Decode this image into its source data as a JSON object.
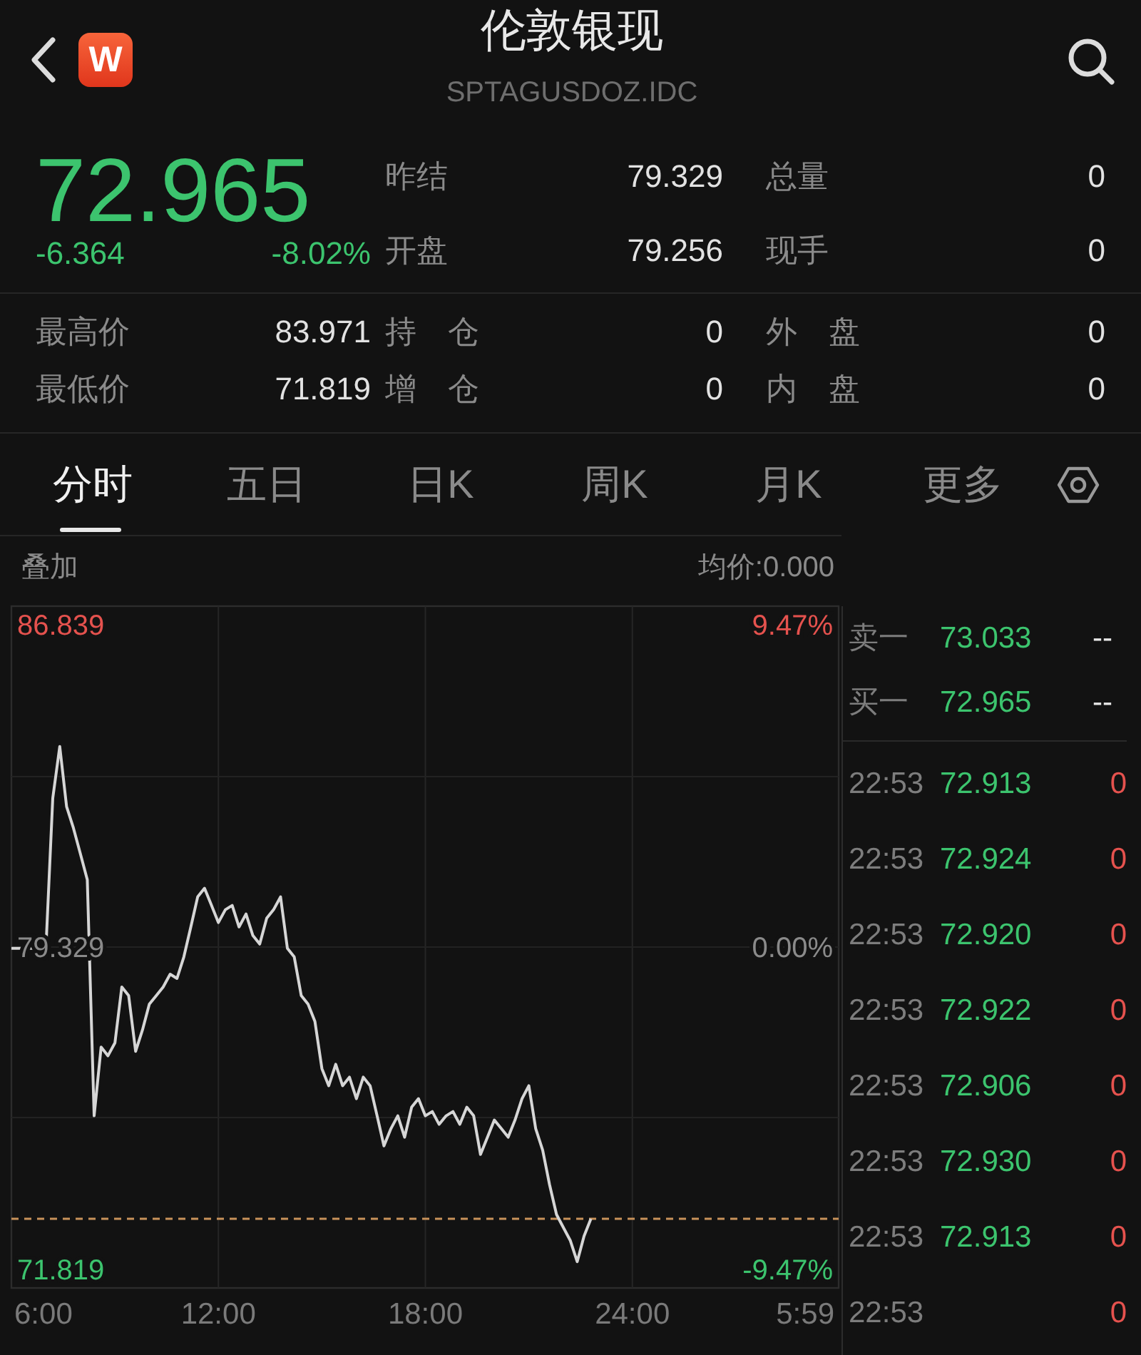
{
  "header": {
    "app_badge": "W",
    "title": "伦敦银现",
    "subtitle": "SPTAGUSDOZ.IDC"
  },
  "quote": {
    "price": "72.965",
    "change": "-6.364",
    "change_percent": "-8.02%",
    "down": true,
    "stats": [
      {
        "label": "昨结",
        "value": "79.329"
      },
      {
        "label": "总量",
        "value": "0"
      },
      {
        "label": "开盘",
        "value": "79.256"
      },
      {
        "label": "现手",
        "value": "0"
      }
    ]
  },
  "details": [
    {
      "label": "最高价",
      "value": "83.971"
    },
    {
      "label": "持　仓",
      "value": "0"
    },
    {
      "label": "外　盘",
      "value": "0"
    },
    {
      "label": "最低价",
      "value": "71.819"
    },
    {
      "label": "增　仓",
      "value": "0"
    },
    {
      "label": "内　盘",
      "value": "0"
    }
  ],
  "tabs": [
    {
      "label": "分时",
      "selected": true
    },
    {
      "label": "五日",
      "selected": false
    },
    {
      "label": "日K",
      "selected": false
    },
    {
      "label": "周K",
      "selected": false
    },
    {
      "label": "月K",
      "selected": false
    },
    {
      "label": "更多",
      "selected": false
    }
  ],
  "chart": {
    "overlay_label": "叠加",
    "average_price": "均价:0.000",
    "percent_labels": [
      "9.47%",
      "0.00%",
      "-9.47%"
    ],
    "end_time_label": "5:59",
    "chart_data": {
      "type": "line",
      "x": [
        6,
        6.2,
        6.4,
        6.6,
        6.8,
        7,
        7.2,
        7.4,
        7.6,
        7.8,
        8,
        8.2,
        8.4,
        8.6,
        8.8,
        9,
        9.2,
        9.4,
        9.6,
        9.8,
        10,
        10.2,
        10.4,
        10.6,
        10.8,
        11,
        11.2,
        11.4,
        11.6,
        11.8,
        12,
        12.2,
        12.4,
        12.6,
        12.8,
        13,
        13.2,
        13.4,
        13.6,
        13.8,
        14,
        14.2,
        14.4,
        14.6,
        14.8,
        15,
        15.2,
        15.4,
        15.6,
        15.8,
        16,
        16.2,
        16.4,
        16.6,
        16.8,
        17,
        17.2,
        17.4,
        17.6,
        17.8,
        18,
        18.2,
        18.4,
        18.6,
        18.8,
        19,
        19.2,
        19.4,
        19.6,
        19.8,
        20,
        20.2,
        20.4,
        20.6,
        20.8,
        21,
        21.2,
        21.4,
        21.6,
        21.8,
        22,
        22.2,
        22.4,
        22.6,
        22.8
      ],
      "values": [
        79.3,
        79.3,
        79.3,
        79.3,
        79.3,
        79.3,
        82.8,
        84.0,
        82.6,
        82.1,
        81.5,
        80.9,
        75.4,
        77.0,
        76.8,
        77.1,
        78.4,
        78.2,
        76.9,
        77.4,
        78.0,
        78.2,
        78.4,
        78.7,
        78.6,
        79.1,
        79.8,
        80.5,
        80.7,
        80.3,
        79.9,
        80.2,
        80.3,
        79.8,
        80.1,
        79.6,
        79.4,
        80.0,
        80.2,
        80.5,
        79.3,
        79.1,
        78.2,
        78.0,
        77.6,
        76.5,
        76.1,
        76.6,
        76.1,
        76.3,
        75.8,
        76.3,
        76.1,
        75.4,
        74.7,
        75.1,
        75.4,
        74.9,
        75.6,
        75.8,
        75.4,
        75.5,
        75.2,
        75.4,
        75.5,
        75.2,
        75.6,
        75.4,
        74.5,
        74.9,
        75.3,
        75.1,
        74.9,
        75.3,
        75.8,
        76.1,
        75.1,
        74.6,
        73.8,
        73.1,
        72.8,
        72.5,
        72.0,
        72.6,
        73.0
      ],
      "xlim": [
        6,
        29.98
      ],
      "ylim": [
        71.39,
        87.27
      ],
      "xticks": [
        {
          "value": 6,
          "label": "6:00"
        },
        {
          "value": 12,
          "label": "12:00"
        },
        {
          "value": 18,
          "label": "18:00"
        },
        {
          "value": 24,
          "label": "24:00"
        }
      ],
      "yticks": [
        {
          "value": 86.839,
          "label": "86.839"
        },
        {
          "value": 79.329,
          "label": "79.329"
        },
        {
          "value": 71.819,
          "label": "71.819"
        }
      ],
      "grid": true,
      "ref_lines": [
        {
          "axis": "y",
          "value": 73.0
        }
      ]
    }
  },
  "order_book": [
    {
      "label": "卖一",
      "price": "73.033",
      "volume": "--",
      "down": true
    },
    {
      "label": "买一",
      "price": "72.965",
      "volume": "--",
      "down": true
    }
  ],
  "trades": [
    {
      "time": "22:53",
      "price": "72.913",
      "volume": "0"
    },
    {
      "time": "22:53",
      "price": "72.924",
      "volume": "0"
    },
    {
      "time": "22:53",
      "price": "72.920",
      "volume": "0"
    },
    {
      "time": "22:53",
      "price": "72.922",
      "volume": "0"
    },
    {
      "time": "22:53",
      "price": "72.906",
      "volume": "0"
    },
    {
      "time": "22:53",
      "price": "72.930",
      "volume": "0"
    },
    {
      "time": "22:53",
      "price": "72.913",
      "volume": "0"
    },
    {
      "time": "22:53",
      "volume": "0"
    }
  ]
}
